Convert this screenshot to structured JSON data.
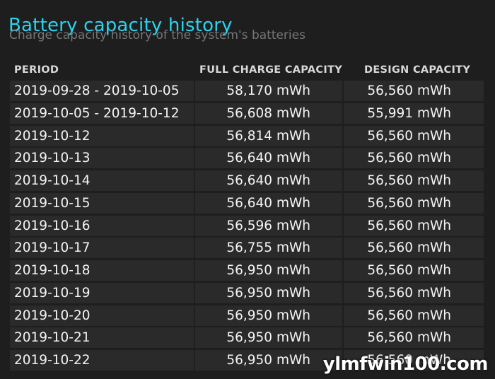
{
  "title": "Battery capacity history",
  "subtitle": "Charge capacity history of the system's batteries",
  "table": {
    "headers": {
      "period": "PERIOD",
      "full_charge_capacity": "FULL CHARGE CAPACITY",
      "design_capacity": "DESIGN CAPACITY"
    },
    "rows": [
      {
        "period": "2019-09-28 - 2019-10-05",
        "full": "58,170 mWh",
        "design": "56,560 mWh"
      },
      {
        "period": "2019-10-05 - 2019-10-12",
        "full": "56,608 mWh",
        "design": "55,991 mWh"
      },
      {
        "period": "2019-10-12",
        "full": "56,814 mWh",
        "design": "56,560 mWh"
      },
      {
        "period": "2019-10-13",
        "full": "56,640 mWh",
        "design": "56,560 mWh"
      },
      {
        "period": "2019-10-14",
        "full": "56,640 mWh",
        "design": "56,560 mWh"
      },
      {
        "period": "2019-10-15",
        "full": "56,640 mWh",
        "design": "56,560 mWh"
      },
      {
        "period": "2019-10-16",
        "full": "56,596 mWh",
        "design": "56,560 mWh"
      },
      {
        "period": "2019-10-17",
        "full": "56,755 mWh",
        "design": "56,560 mWh"
      },
      {
        "period": "2019-10-18",
        "full": "56,950 mWh",
        "design": "56,560 mWh"
      },
      {
        "period": "2019-10-19",
        "full": "56,950 mWh",
        "design": "56,560 mWh"
      },
      {
        "period": "2019-10-20",
        "full": "56,950 mWh",
        "design": "56,560 mWh"
      },
      {
        "period": "2019-10-21",
        "full": "56,950 mWh",
        "design": "56,560 mWh"
      },
      {
        "period": "2019-10-22",
        "full": "56,950 mWh",
        "design": "56,560 mWh"
      }
    ]
  },
  "watermark": "ylmfwin100.com",
  "colors": {
    "background": "#1e1e1e",
    "title": "#2ad4f0",
    "subtitle": "#777777",
    "cell": "#2a2a2a"
  }
}
